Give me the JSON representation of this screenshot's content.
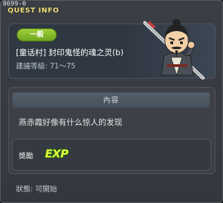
{
  "window": {
    "debug_id": "8699-0",
    "title": "QUEST INFO"
  },
  "quest": {
    "category": "一般",
    "name": "[童话村] 封印鬼怪的魂之灵(b)",
    "level_range": "建議等級: 71～75"
  },
  "content": {
    "header": "內容",
    "description": "燕赤霞好像有什么惊人的发现"
  },
  "reward": {
    "label": "獎勵",
    "exp_text": "EXP"
  },
  "status": {
    "text": "狀態: 可開始"
  },
  "colors": {
    "title": "#f2e27a",
    "category_pill": "#8cc230",
    "exp": "#e8ff3a",
    "panel": "#3d4047"
  },
  "npc": {
    "icon": "npc-swordsman-portrait-icon"
  }
}
